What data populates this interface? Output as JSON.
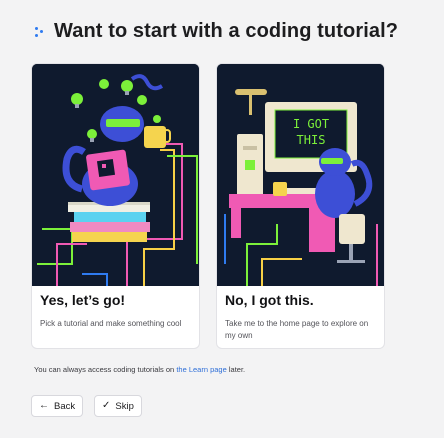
{
  "header": {
    "title": "Want to start with a coding tutorial?"
  },
  "cards": [
    {
      "title": "Yes, let’s go!",
      "description": "Pick a tutorial and make something cool"
    },
    {
      "title": "No, I got this.",
      "description": "Take me to the home page to explore on my own",
      "screen_text_line1": "I GOT",
      "screen_text_line2": "THIS"
    }
  ],
  "note": {
    "before": "You can always access coding tutorials on ",
    "link": "the Learn page",
    "after": " later."
  },
  "buttons": {
    "back_label": "Back",
    "back_icon": "arrow-left-icon",
    "skip_label": "Skip",
    "skip_icon": "check-icon"
  },
  "colors": {
    "accent": "#2f7bf0",
    "art_bg": "#0f1a2e",
    "screen_green": "#7cf03a",
    "pink": "#f05ab4"
  }
}
